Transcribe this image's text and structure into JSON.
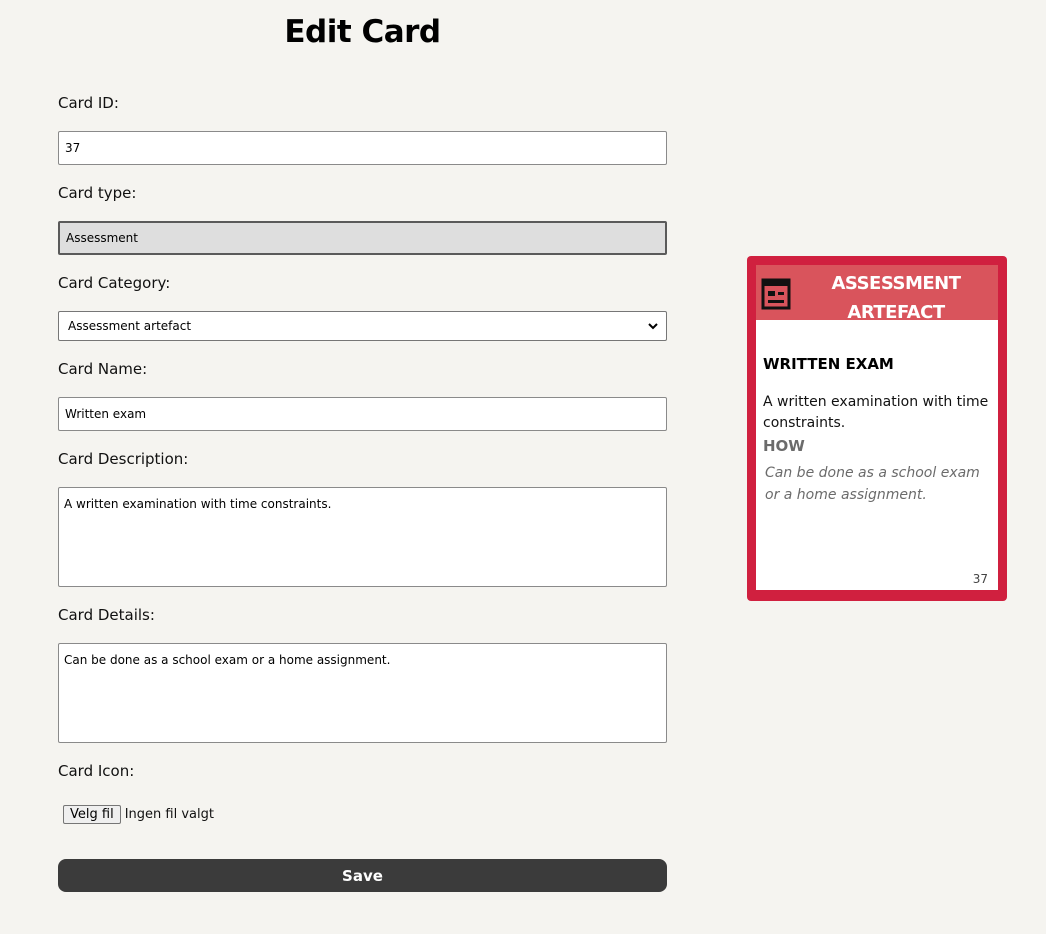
{
  "page": {
    "title": "Edit Card"
  },
  "form": {
    "id_label": "Card ID:",
    "id_value": "37",
    "type_label": "Card type:",
    "type_value": "Assessment",
    "category_label": "Card Category:",
    "category_value": "Assessment artefact",
    "name_label": "Card Name:",
    "name_value": "Written exam",
    "description_label": "Card Description:",
    "description_value": "A written examination with time constraints.",
    "details_label": "Card Details:",
    "details_value": "Can be done as a school exam or a home assignment.",
    "icon_label": "Card Icon:",
    "file_button": "Velg fil",
    "file_status": "Ingen fil valgt",
    "save_label": "Save"
  },
  "card": {
    "category": "ASSESSMENT ARTEFACT",
    "icon": "article-icon",
    "name": "WRITTEN EXAM",
    "description": "A written examination with time constraints.",
    "how_label": "HOW",
    "details": "Can be done as a school exam or a home assignment.",
    "number": "37",
    "colors": {
      "border": "#d0203f",
      "header": "#d9545c"
    }
  }
}
